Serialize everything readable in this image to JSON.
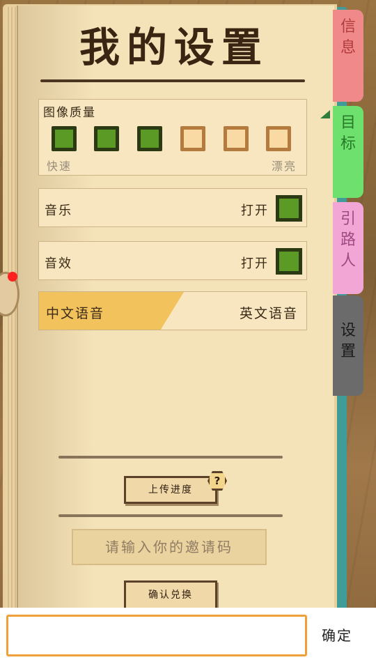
{
  "title": "我的设置",
  "tabs": [
    {
      "label": "信息",
      "chars": [
        "信",
        "息"
      ],
      "color": "#f08a8a",
      "text_color": "#b13b3b"
    },
    {
      "label": "目标",
      "chars": [
        "目",
        "标"
      ],
      "color": "#6ee06e",
      "text_color": "#267a26"
    },
    {
      "label": "引路人",
      "chars": [
        "引",
        "路",
        "人"
      ],
      "color": "#f2a6d6",
      "text_color": "#a04a82"
    },
    {
      "label": "设置",
      "chars": [
        "设",
        "置"
      ],
      "color": "#6b6b6b",
      "text_color": "#1a1a1a",
      "active": true
    }
  ],
  "graphics": {
    "label": "图像质量",
    "fast_label": "快速",
    "pretty_label": "漂亮",
    "levels": [
      true,
      true,
      true,
      false,
      false,
      false
    ]
  },
  "music": {
    "label": "音乐",
    "state_label": "打开",
    "on": true
  },
  "sound": {
    "label": "音效",
    "state_label": "打开",
    "on": true
  },
  "language": {
    "chinese_label": "中文语音",
    "english_label": "英文语音",
    "selected": "chinese"
  },
  "upload_button": {
    "label": "上传进度"
  },
  "help_icon": {
    "glyph": "?"
  },
  "invite": {
    "placeholder": "请输入你的邀请码"
  },
  "redeem_button": {
    "label": "确认兑换"
  },
  "bottom": {
    "confirm_label": "确定"
  },
  "colors": {
    "accent_green": "#5b9a25",
    "lang_highlight": "#f2c35c",
    "input_border": "#f0a038"
  }
}
